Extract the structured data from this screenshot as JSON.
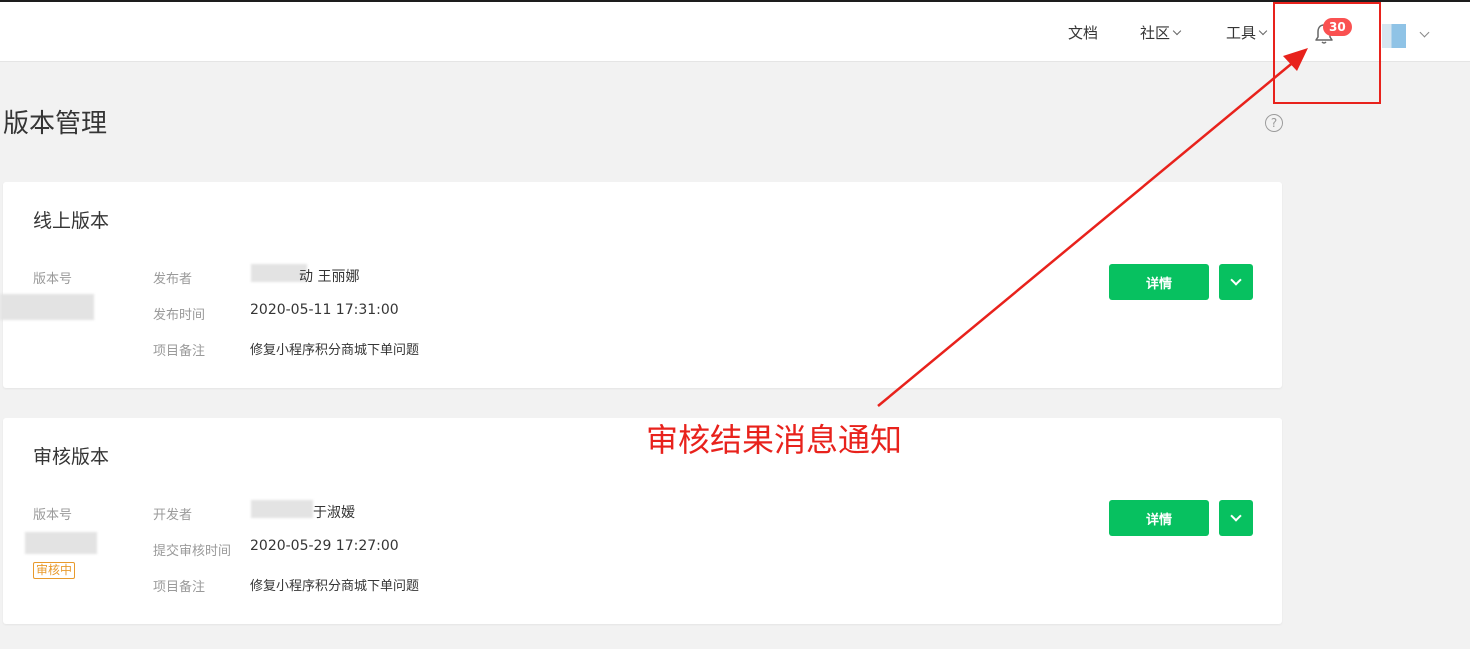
{
  "header": {
    "nav": [
      {
        "label": "文档",
        "has_dropdown": false
      },
      {
        "label": "社区",
        "has_dropdown": true
      },
      {
        "label": "工具",
        "has_dropdown": true
      }
    ],
    "notification_count": "30",
    "bell_icon": "bell-icon",
    "avatar_icon": "avatar"
  },
  "page": {
    "title": "版本管理",
    "help_icon": "question-circle-icon",
    "help_glyph": "?"
  },
  "online_version": {
    "title": "线上版本",
    "version_label": "版本号",
    "publisher_label": "发布者",
    "publisher_value": "动 王丽娜",
    "time_label": "发布时间",
    "time_value": "2020-05-11 17:31:00",
    "note_label": "项目备注",
    "note_value": "修复小程序积分商城下单问题",
    "detail_button": "详情"
  },
  "review_version": {
    "title": "审核版本",
    "version_label": "版本号",
    "status_tag": "审核中",
    "developer_label": "开发者",
    "developer_value": "于淑嫒",
    "time_label": "提交审核时间",
    "time_value": "2020-05-29 17:27:00",
    "note_label": "项目备注",
    "note_value": "修复小程序积分商城下单问题",
    "detail_button": "详情"
  },
  "annotation": {
    "callout_text": "审核结果消息通知",
    "color": "#e8221c"
  },
  "colors": {
    "primary_green": "#07c160",
    "badge_red": "#fa5151",
    "status_orange": "#e89a2c"
  }
}
